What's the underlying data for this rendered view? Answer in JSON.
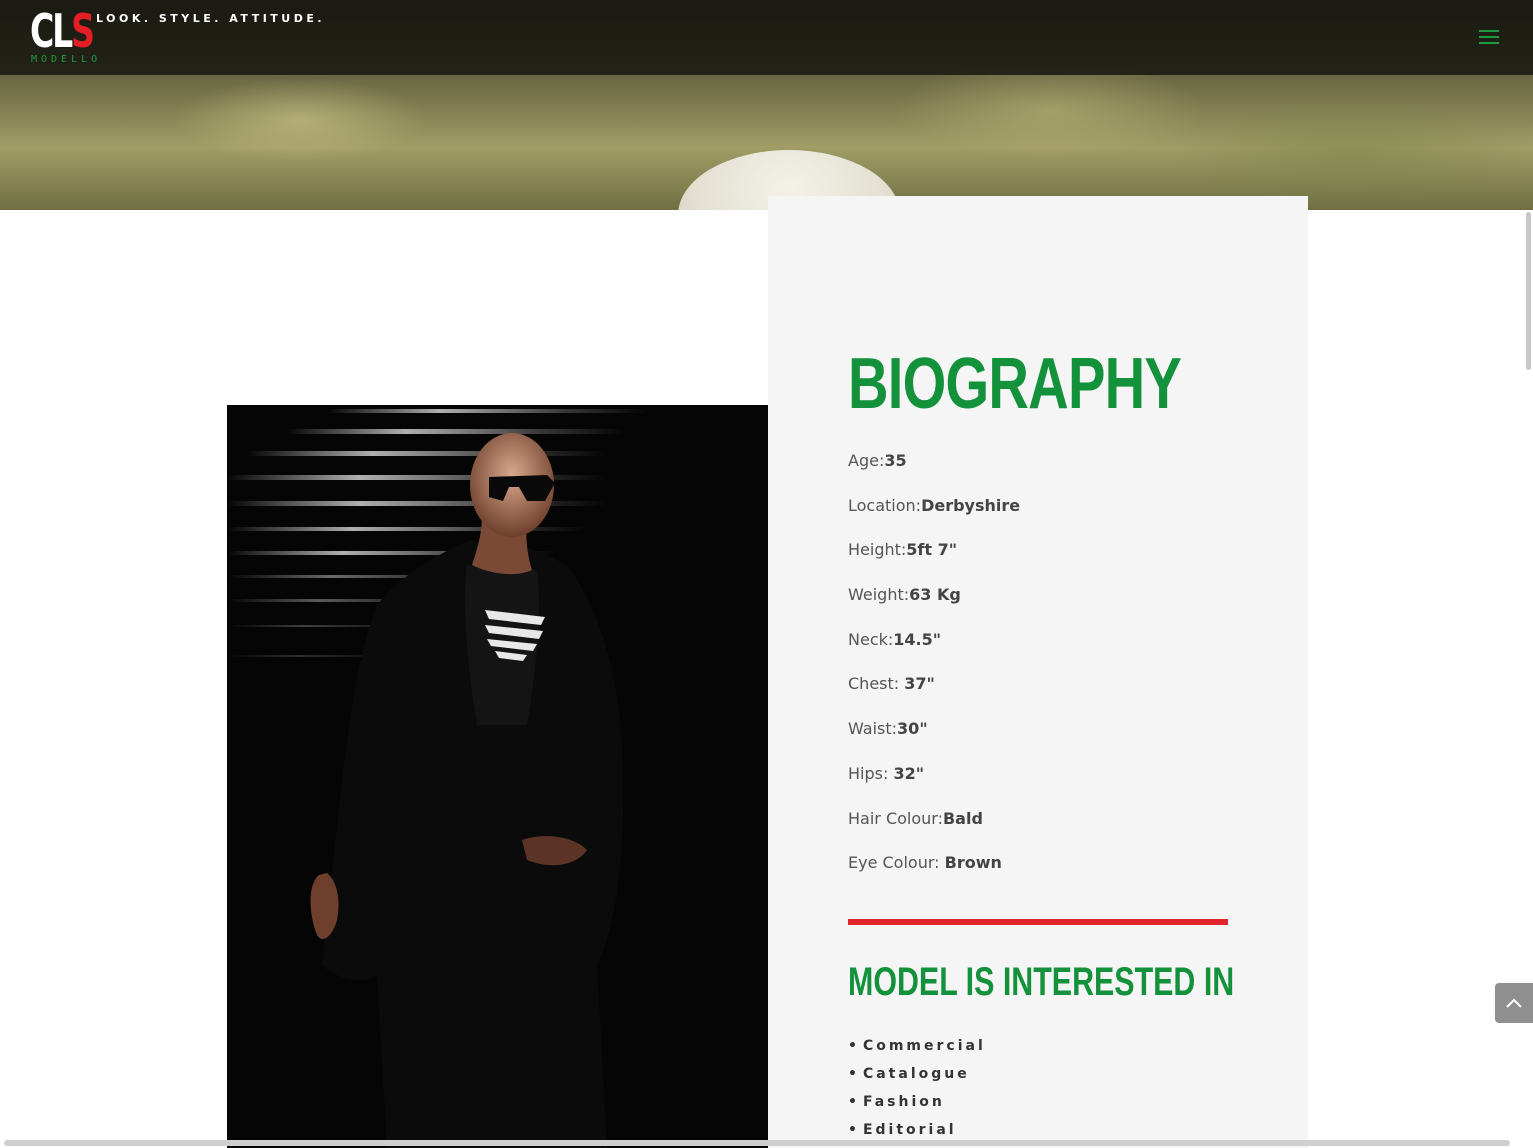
{
  "header": {
    "logo": {
      "c": "C",
      "l": "L",
      "s": "S",
      "sub": "MODELLO"
    },
    "tagline": "LOOK. STYLE. ATTITUDE."
  },
  "bio": {
    "title": "BIOGRAPHY",
    "facts": [
      {
        "label": "Age:",
        "value": "35"
      },
      {
        "label": "Location:",
        "value": "Derbyshire"
      },
      {
        "label": "Height:",
        "value": "5ft 7\""
      },
      {
        "label": "Weight:",
        "value": "63 Kg"
      },
      {
        "label": "Neck:",
        "value": "14.5\""
      },
      {
        "label": "Chest: ",
        "value": "37\""
      },
      {
        "label": "Waist:",
        "value": "30\""
      },
      {
        "label": "Hips: ",
        "value": "32\""
      },
      {
        "label": "Hair Colour:",
        "value": "Bald"
      },
      {
        "label": "Eye Colour: ",
        "value": "Brown"
      }
    ]
  },
  "interests": {
    "title": "MODEL IS INTERESTED IN",
    "items": [
      "Commercial",
      "Catalogue",
      "Fashion",
      "Editorial"
    ]
  },
  "icons": {
    "menu": "hamburger-icon",
    "back_to_top": "chevron-up-icon"
  },
  "colors": {
    "brand_green": "#14913b",
    "brand_red": "#e0242b",
    "card_bg": "#f5f5f5"
  }
}
